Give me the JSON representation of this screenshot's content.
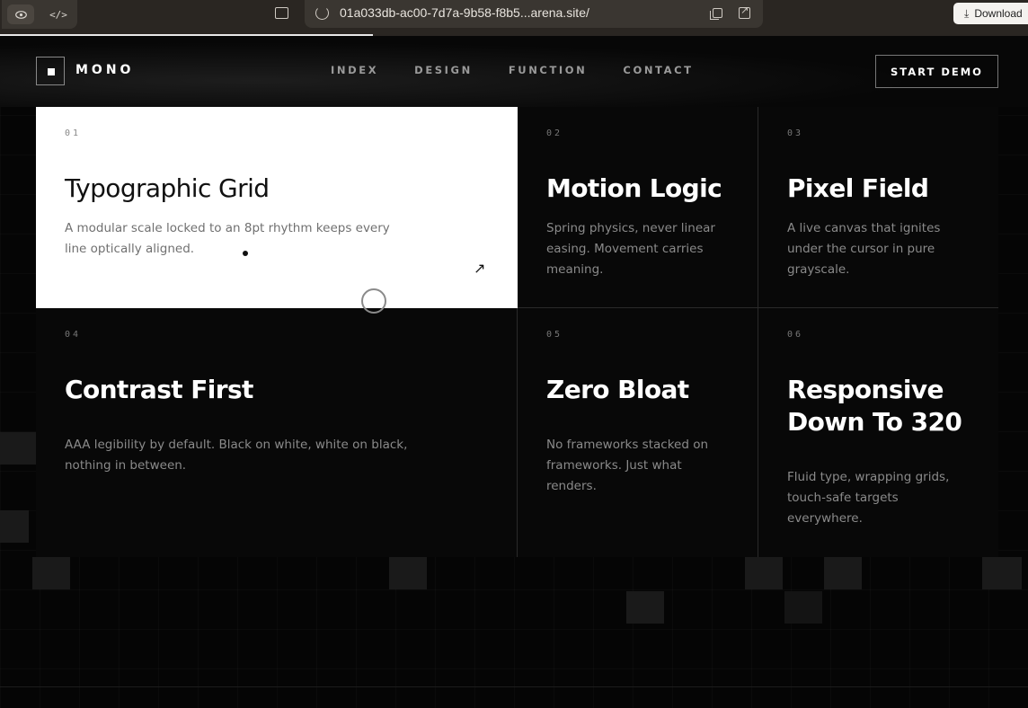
{
  "browser": {
    "url": "01a033db-ac00-7d7a-9b58-f8b5...arena.site/",
    "download_label": "Download",
    "view_icon": "eye-icon",
    "code_icon": "</>"
  },
  "brand": {
    "name": "MONO"
  },
  "nav": [
    {
      "label": "INDEX"
    },
    {
      "label": "DESIGN"
    },
    {
      "label": "FUNCTION"
    },
    {
      "label": "CONTACT"
    }
  ],
  "cta": {
    "label": "START DEMO"
  },
  "cards": [
    {
      "num": "01",
      "title": "Typographic Grid",
      "desc": "A modular scale locked to an 8pt rhythm keeps every line optically aligned.",
      "active": true,
      "arrow": "↗"
    },
    {
      "num": "02",
      "title": "Motion Logic",
      "desc": "Spring physics, never linear easing. Movement carries meaning."
    },
    {
      "num": "03",
      "title": "Pixel Field",
      "desc": "A live canvas that ignites under the cursor in pure grayscale."
    },
    {
      "num": "04",
      "title": "Contrast First",
      "desc": "AAA legibility by default. Black on white, white on black, nothing in between."
    },
    {
      "num": "05",
      "title": "Zero Bloat",
      "desc": "No frameworks stacked on frameworks. Just what renders."
    },
    {
      "num": "06",
      "title": "Responsive Down To 320",
      "desc": "Fluid type, wrapping grids, touch-safe targets everywhere."
    }
  ],
  "colors": {
    "background": "#050505",
    "accent": "#ffffff",
    "muted_text": "#8a8a8a"
  }
}
